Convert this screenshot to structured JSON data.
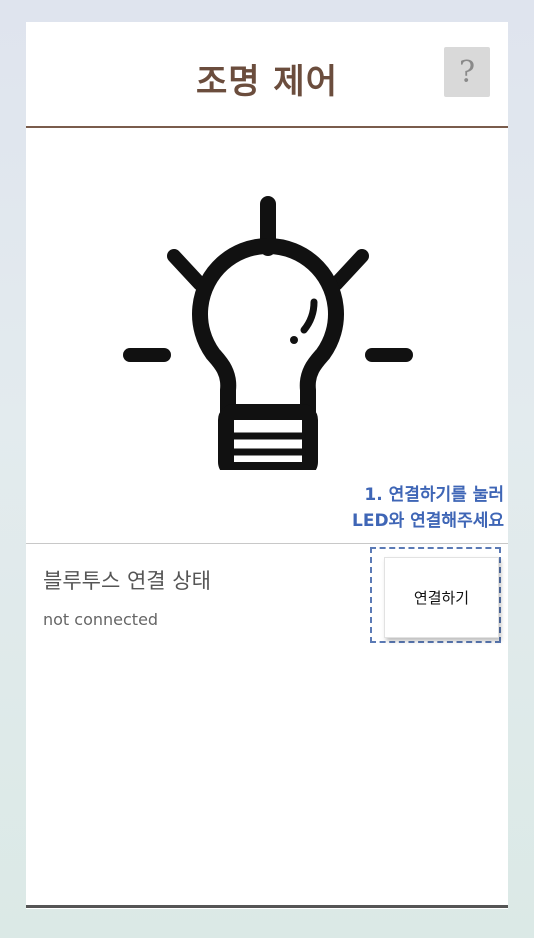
{
  "header": {
    "title": "조명 제어",
    "help_label": "?"
  },
  "bulb": {
    "icon": "lightbulb-icon"
  },
  "hint": {
    "line1": "1. 연결하기를 눌러",
    "line2": "LED와 연결해주세요"
  },
  "bluetooth": {
    "label": "블루투스 연결 상태",
    "status": "not connected",
    "connect_label": "연결하기"
  },
  "colors": {
    "title": "#6b4d3d",
    "header_divider": "#7a5c4c",
    "hint": "#3f66b6",
    "icon": "#111111"
  }
}
